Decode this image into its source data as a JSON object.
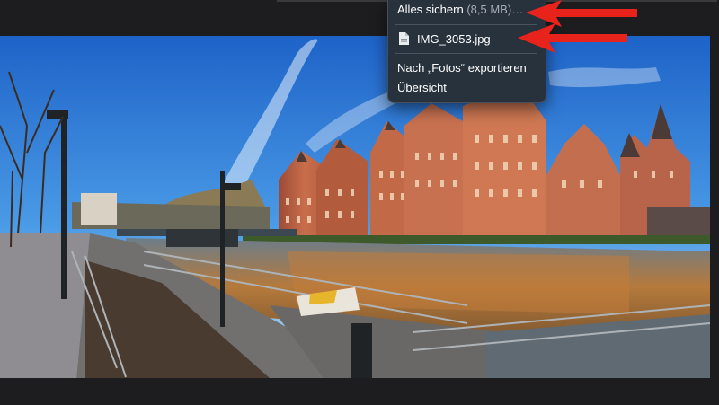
{
  "menu": {
    "save_all_label": "Alles sichern",
    "save_all_size": "(8,5 MB)…",
    "file_name": "IMG_3053.jpg",
    "export_label": "Nach „Fotos“ exportieren",
    "overview_label": "Übersicht"
  },
  "icons": {
    "file": "document-icon",
    "annotation_arrow": "red-arrow-icon"
  },
  "colors": {
    "menu_bg": "#28323c",
    "arrow": "#e8231c",
    "chrome": "#1d1d1f"
  }
}
